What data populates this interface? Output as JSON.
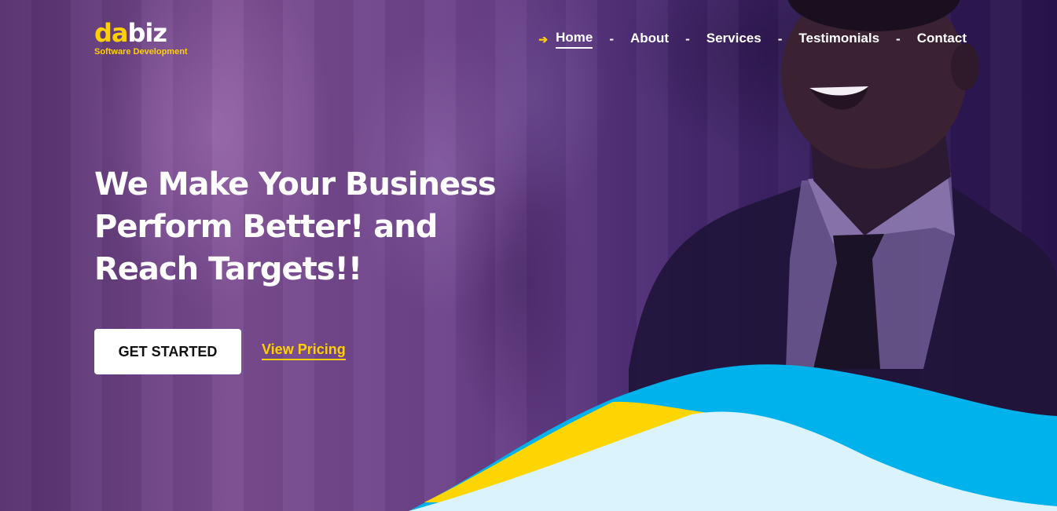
{
  "brand": {
    "logo_part1": "da",
    "logo_part2": "biz",
    "tagline": "Software Development"
  },
  "nav": {
    "items": [
      {
        "label": "Home",
        "active": true
      },
      {
        "label": "About"
      },
      {
        "label": "Services"
      },
      {
        "label": "Testimonials"
      },
      {
        "label": "Contact"
      }
    ],
    "separator": "-",
    "active_icon": "arrow-right-icon"
  },
  "hero": {
    "headline_line1": "We Make Your Business",
    "headline_line2": "Perform Better! and",
    "headline_line3": "Reach Targets!!",
    "cta_primary": "GET STARTED",
    "cta_secondary": "View Pricing"
  },
  "colors": {
    "accent": "#ffd000",
    "overlay": "#4d2a70",
    "wave_blue": "#00b2ec",
    "wave_light": "#dbf3fd",
    "wave_yellow": "#ffd500"
  }
}
